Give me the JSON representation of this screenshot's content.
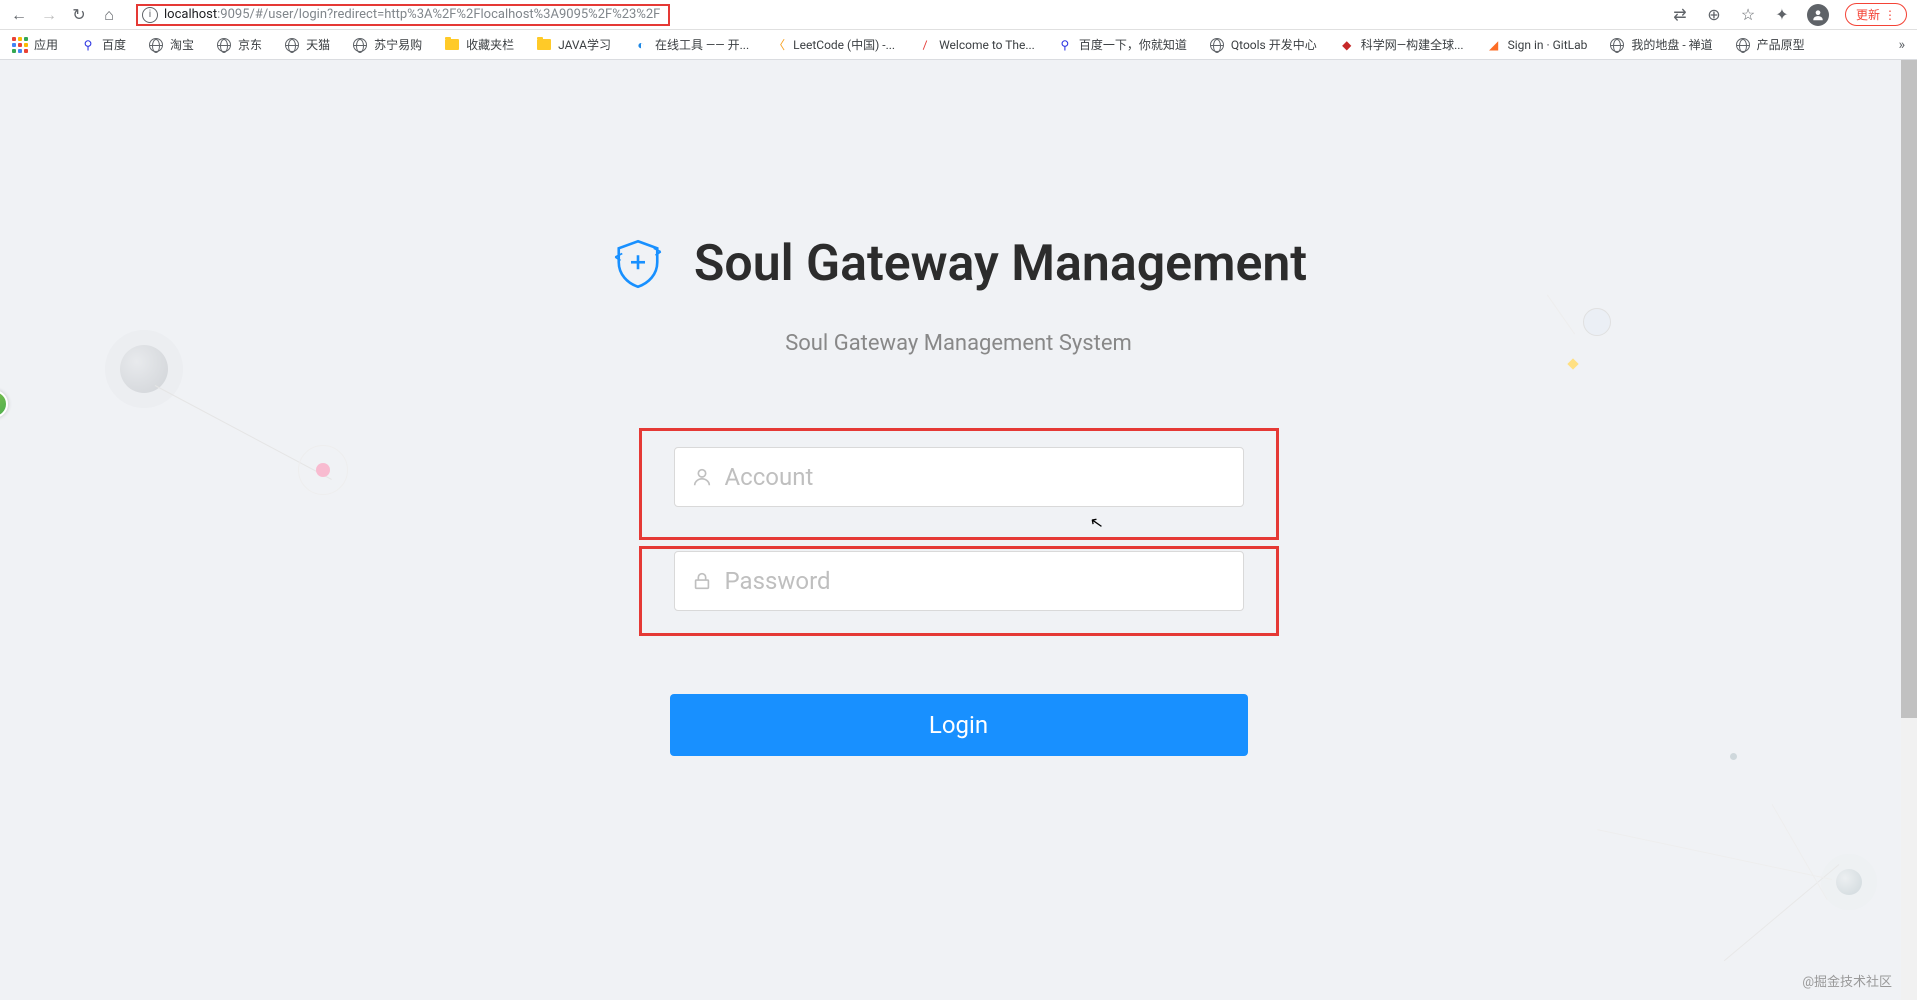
{
  "browser": {
    "url_host": "localhost",
    "url_rest": ":9095/#/user/login?redirect=http%3A%2F%2Flocalhost%3A9095%2F%23%2F",
    "update_label": "更新"
  },
  "bookmarks": {
    "apps": "应用",
    "items": [
      {
        "label": "百度"
      },
      {
        "label": "淘宝"
      },
      {
        "label": "京东"
      },
      {
        "label": "天猫"
      },
      {
        "label": "苏宁易购"
      },
      {
        "label": "收藏夹栏"
      },
      {
        "label": "JAVA学习"
      },
      {
        "label": "在线工具 —— 开..."
      },
      {
        "label": "LeetCode (中国) -..."
      },
      {
        "label": "Welcome to The..."
      },
      {
        "label": "百度一下，你就知道"
      },
      {
        "label": "Qtools 开发中心"
      },
      {
        "label": "科学网—构建全球..."
      },
      {
        "label": "Sign in · GitLab"
      },
      {
        "label": "我的地盘 - 禅道"
      },
      {
        "label": "产品原型"
      }
    ]
  },
  "page": {
    "title": "Soul Gateway Management",
    "subtitle": "Soul Gateway Management System",
    "account_placeholder": "Account",
    "password_placeholder": "Password",
    "login_button": "Login"
  },
  "watermark": "@掘金技术社区"
}
